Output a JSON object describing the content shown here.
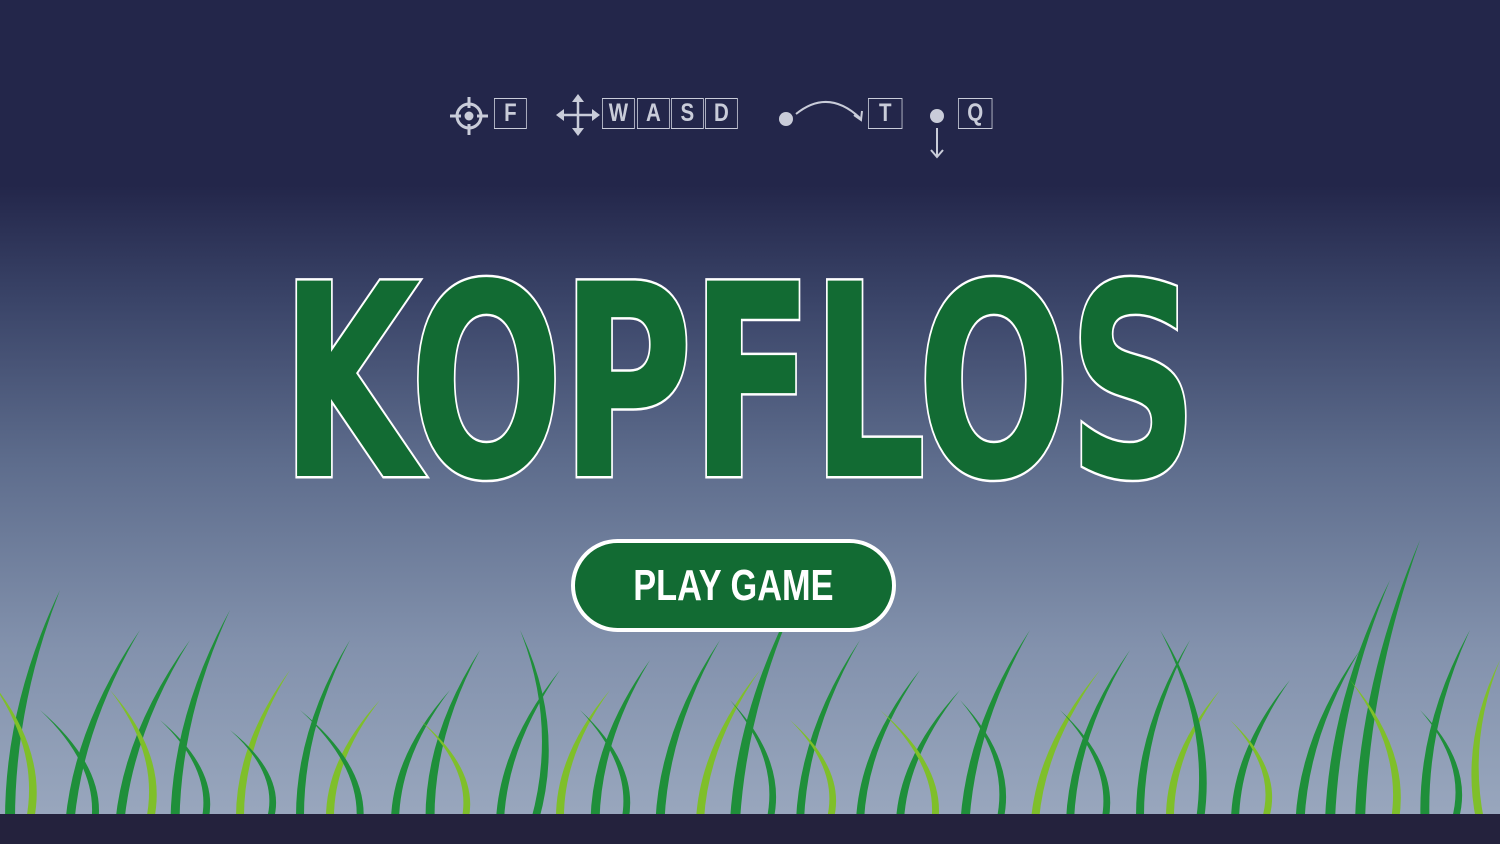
{
  "game": {
    "title": "KOPFLOS",
    "play_button_label": "PLAY GAME"
  },
  "controls": [
    {
      "icon": "crosshair-icon",
      "keys": [
        "F"
      ]
    },
    {
      "icon": "move-arrows-icon",
      "keys": [
        "W",
        "A",
        "S",
        "D"
      ]
    },
    {
      "icon": "throw-arc-icon",
      "keys": [
        "T"
      ]
    },
    {
      "icon": "drop-down-icon",
      "keys": [
        "Q"
      ]
    }
  ],
  "colors": {
    "sky_top": "#23264a",
    "sky_bottom": "#98a6bd",
    "title_fill": "#126b33",
    "title_outline": "#ffffff",
    "button_fill": "#126b33",
    "grass_dark": "#1f8f3a",
    "grass_light": "#7fbf2a",
    "ground": "#24223d",
    "legend": "#c9ccd9"
  }
}
